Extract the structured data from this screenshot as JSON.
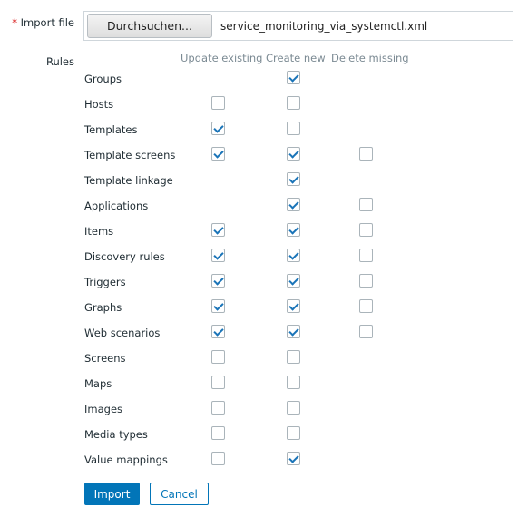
{
  "import_file": {
    "required_mark": "*",
    "label": "Import file",
    "browse_label": "Durchsuchen...",
    "file_name": "service_monitoring_via_systemctl.xml"
  },
  "rules": {
    "label": "Rules",
    "columns": [
      "Update existing",
      "Create new",
      "Delete missing"
    ],
    "items": [
      {
        "label": "Groups",
        "update": null,
        "create": true,
        "delete": null
      },
      {
        "label": "Hosts",
        "update": false,
        "create": false,
        "delete": null
      },
      {
        "label": "Templates",
        "update": true,
        "create": false,
        "delete": null
      },
      {
        "label": "Template screens",
        "update": true,
        "create": true,
        "delete": false
      },
      {
        "label": "Template linkage",
        "update": null,
        "create": true,
        "delete": null
      },
      {
        "label": "Applications",
        "update": null,
        "create": true,
        "delete": false
      },
      {
        "label": "Items",
        "update": true,
        "create": true,
        "delete": false
      },
      {
        "label": "Discovery rules",
        "update": true,
        "create": true,
        "delete": false
      },
      {
        "label": "Triggers",
        "update": true,
        "create": true,
        "delete": false
      },
      {
        "label": "Graphs",
        "update": true,
        "create": true,
        "delete": false
      },
      {
        "label": "Web scenarios",
        "update": true,
        "create": true,
        "delete": false
      },
      {
        "label": "Screens",
        "update": false,
        "create": false,
        "delete": null
      },
      {
        "label": "Maps",
        "update": false,
        "create": false,
        "delete": null
      },
      {
        "label": "Images",
        "update": false,
        "create": false,
        "delete": null
      },
      {
        "label": "Media types",
        "update": false,
        "create": false,
        "delete": null
      },
      {
        "label": "Value mappings",
        "update": false,
        "create": true,
        "delete": null
      }
    ]
  },
  "buttons": {
    "import": "Import",
    "cancel": "Cancel"
  },
  "colors": {
    "accent": "#0275b8",
    "required": "#d40000"
  }
}
